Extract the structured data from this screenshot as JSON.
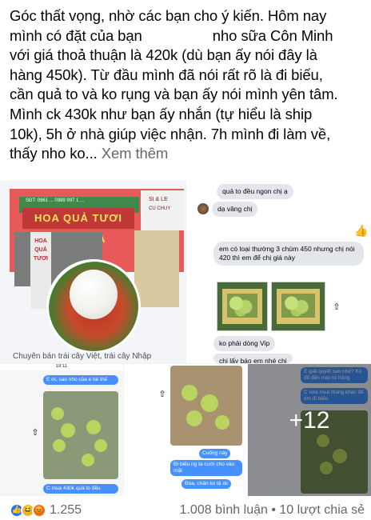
{
  "post": {
    "line1": "Góc thất vọng, nhờ các bạn cho ý kiến. Hôm nay",
    "line2a": "mình có đặt của bạn",
    "line2b": "nho sữa Côn Minh",
    "line3": "với giá thoả thuận là 420k (dù bạn ấy nói đây là",
    "line4": "hàng 450k). Từ đầu mình đã nói rất rõ là đi biếu,",
    "line5": "cần quả to và ko rụng và bạn ấy nói mình yên tâm.",
    "line6": "Mình ck 430k như bạn ấy nhắn (tự hiểu là ship",
    "line7": "10k), 5h ở nhà giúp việc nhận. 7h mình đi làm về,",
    "line8": "thấy nho ko...",
    "see_more": "Xem thêm"
  },
  "shop_tile": {
    "sign_text": "HOA QUẢ TƯƠI ĐÔN MÙA",
    "sign_small_left": "SĐT: 0961 ... 0989 997 1 ...",
    "sign_small_right": "SI & LE",
    "sign_small_right2": "CU CHUY",
    "pillar_text": "HOA QUẢ TƯƠI",
    "caption": "Chuyên bán  trái cây Việt, trái cây Nhập"
  },
  "chat_top": {
    "msg1": "quả to đều ngon chị ạ",
    "msg2": "dạ vâng chị",
    "msg3": "em có loại thường 3 chùm 450 nhưng chị nói 420 thì em để chị giá này",
    "msg4": "ko phải dòng Vip",
    "msg5": "chị lấy báo em nhé chị"
  },
  "chat_bottom_left": {
    "time": "19:11",
    "msg1": "E ơi, sao nho của e bé thế",
    "msg2": "C mua 430k quả to đều"
  },
  "chat_bottom_mid": {
    "msg1": "Cuống này",
    "msg2": "Đi biếu ng ta cười cho vào mặt",
    "msg3": "Đùa, chán ko tả dc"
  },
  "chat_bottom_right": {
    "msg1": "E giải quyết sao nhé? Ko để đến mai nó hỏng",
    "msg2": "C vừa mua thùng khác để em đi biếu",
    "more_label": "+12"
  },
  "footer": {
    "reaction_count": "1.255",
    "comments": "1.008 bình luận",
    "separator": " • ",
    "shares": "10 lượt chia sẻ"
  },
  "icons": {
    "like": "like-reaction-icon",
    "haha": "haha-reaction-icon",
    "angry": "angry-reaction-icon",
    "share": "share-icon",
    "thumbs_up": "thumbs-up-icon"
  },
  "colors": {
    "link_grey": "#65676b",
    "facebook_blue": "#1877f2",
    "messenger_blue": "#4791ff"
  }
}
